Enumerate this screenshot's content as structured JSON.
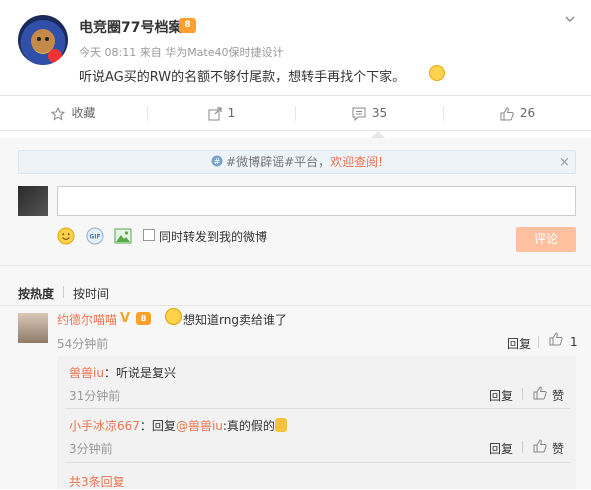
{
  "post": {
    "author": "电竞圈77号档案",
    "vip_badge": "8",
    "meta": "今天 08:11 来自 华为Mate40保时捷设计",
    "text": "听说AG买的RW的名额不够付尾款，想转手再找个下家。"
  },
  "actions": {
    "favorite_label": "收藏",
    "share_count": "1",
    "comment_count": "35",
    "like_count": "26"
  },
  "notice": {
    "hashtag": "#微博辟谣#平台，",
    "welcome": "欢迎查阅!",
    "close": "×"
  },
  "composer": {
    "placeholder": "",
    "forward_label": "同时转发到我的微博",
    "submit_label": "评论"
  },
  "sort": {
    "hot_label": "按热度",
    "time_label": "按时间"
  },
  "top_comment": {
    "name": "约德尔喵喵",
    "v_badge": "V",
    "vip_badge": "8",
    "text": "想知道rng卖给谁了",
    "time": "54分钟前",
    "reply_label": "回复",
    "like_count": "1"
  },
  "replies": [
    {
      "name": "兽兽iu",
      "colon": "：",
      "text": "听说是复兴",
      "time": "31分钟前",
      "reply_label": "回复",
      "like_label": "赞"
    },
    {
      "name": "小手冰凉667",
      "colon": "：",
      "reply_prefix": "回复",
      "mention": "@兽兽iu",
      "text": ":真的假的",
      "time": "3分钟前",
      "reply_label": "回复",
      "like_label": "赞"
    }
  ],
  "more_replies": "共3条回复",
  "colors": {
    "accent": "#eb7350",
    "link": "#eb7350",
    "button_disabled": "#ffc09f",
    "notice_bg": "#eef3f8"
  },
  "icons": {
    "favorite": "star-icon",
    "share": "share-icon",
    "comment": "comment-icon",
    "like": "thumbs-up-icon",
    "chevron": "chevron-down-icon",
    "emoji": "smiley-icon",
    "gif": "gif-icon",
    "image": "image-icon"
  }
}
